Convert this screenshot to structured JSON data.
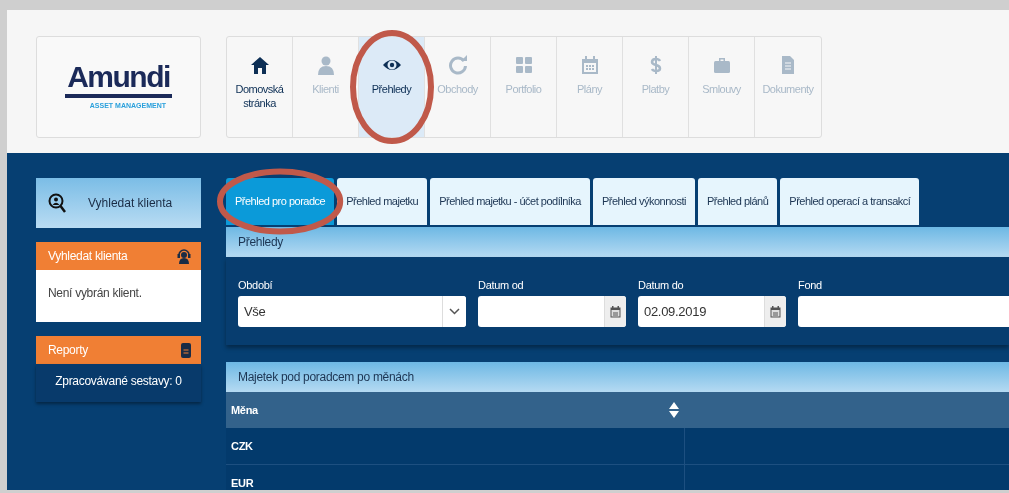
{
  "logo": {
    "name": "Amundi",
    "subtitle": "ASSET MANAGEMENT"
  },
  "nav": [
    {
      "label": "Domovská stránka",
      "kind": "home",
      "selected": false,
      "disabled": false
    },
    {
      "label": "Klienti",
      "kind": "user",
      "selected": false,
      "disabled": true
    },
    {
      "label": "Přehledy",
      "kind": "eye",
      "selected": true,
      "disabled": false
    },
    {
      "label": "Obchody",
      "kind": "refresh",
      "selected": false,
      "disabled": true
    },
    {
      "label": "Portfolio",
      "kind": "grid",
      "selected": false,
      "disabled": true
    },
    {
      "label": "Plány",
      "kind": "calendar",
      "selected": false,
      "disabled": true
    },
    {
      "label": "Platby",
      "kind": "dollar",
      "selected": false,
      "disabled": true
    },
    {
      "label": "Smlouvy",
      "kind": "briefcase",
      "selected": false,
      "disabled": true
    },
    {
      "label": "Dokumenty",
      "kind": "document",
      "selected": false,
      "disabled": true
    }
  ],
  "sidebar": {
    "search_button": "Vyhledat klienta",
    "client_panel": {
      "title": "Vyhledat klienta",
      "text": "Není vybrán klient."
    },
    "reports_panel": {
      "title": "Reporty",
      "text": "Zpracovávané sestavy: 0"
    }
  },
  "tabs": [
    {
      "label": "Přehled pro poradce",
      "selected": true
    },
    {
      "label": "Přehled majetku",
      "selected": false
    },
    {
      "label": "Přehled majetku - účet podílníka",
      "selected": false
    },
    {
      "label": "Přehled výkonnosti",
      "selected": false
    },
    {
      "label": "Přehled plánů",
      "selected": false
    },
    {
      "label": "Přehled operací a transakcí",
      "selected": false
    }
  ],
  "section_title": "Přehledy",
  "filters": [
    {
      "label": "Období",
      "kind": "select",
      "value": "Vše"
    },
    {
      "label": "Datum od",
      "kind": "date"
    },
    {
      "label": "Datum do",
      "kind": "date",
      "value": "02.09.2019"
    },
    {
      "label": "Fond",
      "kind": "text"
    }
  ],
  "table": {
    "title": "Majetek pod poradcem po měnách",
    "columns": [
      "Měna"
    ],
    "rows": [
      [
        "CZK"
      ],
      [
        "EUR"
      ]
    ]
  }
}
